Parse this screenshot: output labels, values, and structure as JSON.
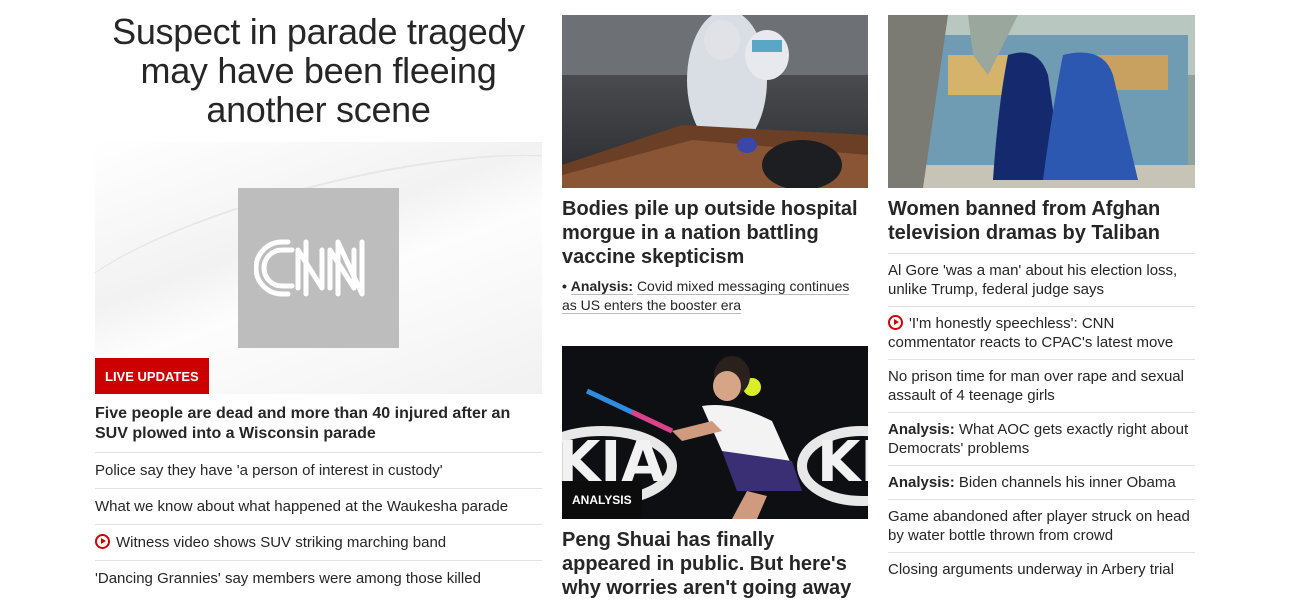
{
  "lead": {
    "headline": "Suspect in parade tragedy may have been fleeing another scene",
    "logo_text": "CNN",
    "badge": "LIVE UPDATES",
    "summary": "Five people are dead and more than 40 injured after an SUV plowed into a Wisconsin parade",
    "related": [
      {
        "text": "Police say they have 'a person of interest in custody'",
        "video": false
      },
      {
        "text": "What we know about what happened at the Waukesha parade",
        "video": false
      },
      {
        "text": "Witness video shows SUV striking marching band",
        "video": true
      },
      {
        "text": "'Dancing Grannies' say members were among those killed",
        "video": false
      }
    ]
  },
  "middle": {
    "story1": {
      "title": "Bodies pile up outside hospital morgue in a nation battling vaccine skepticism",
      "bullet": "•",
      "sub_label": "Analysis:",
      "sub_text": "Covid mixed messaging continues as US enters the booster era"
    },
    "story2": {
      "badge": "ANALYSIS",
      "court_text": "KIA",
      "title": "Peng Shuai has finally appeared in public. But here's why worries aren't going away"
    }
  },
  "right": {
    "title": "Women banned from Afghan television dramas by Taliban",
    "items": [
      {
        "label": "",
        "text": "Al Gore 'was a man' about his election loss, unlike Trump, federal judge says",
        "video": false
      },
      {
        "label": "",
        "text": "'I'm honestly speechless': CNN commentator reacts to CPAC's latest move",
        "video": true
      },
      {
        "label": "",
        "text": "No prison time for man over rape and sexual assault of 4 teenage girls",
        "video": false
      },
      {
        "label": "Analysis:",
        "text": "What AOC gets exactly right about Democrats' problems",
        "video": false
      },
      {
        "label": "Analysis:",
        "text": "Biden channels his inner Obama",
        "video": false
      },
      {
        "label": "",
        "text": "Game abandoned after player struck on head by water bottle thrown from crowd",
        "video": false
      },
      {
        "label": "",
        "text": "Closing arguments underway in Arbery trial",
        "video": false
      }
    ]
  },
  "colors": {
    "brand_red": "#cc0000",
    "text": "#262626",
    "divider": "#e1e1e1"
  },
  "icons": {
    "video": "play-circle-icon"
  }
}
